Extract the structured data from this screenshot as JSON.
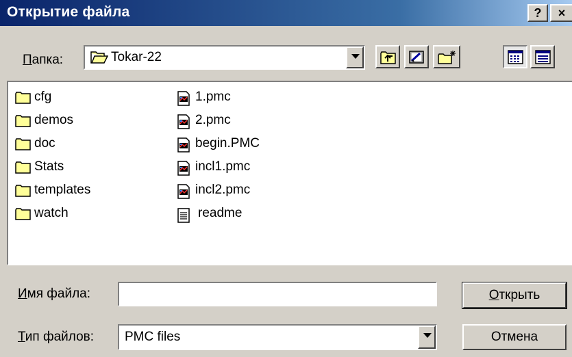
{
  "window": {
    "title": "Открытие файла",
    "help_button": "?",
    "close_button": "×"
  },
  "folder_bar": {
    "label_accel": "П",
    "label_rest": "апка:",
    "current_folder": "Tokar-22"
  },
  "toolbar": {
    "icons": [
      "up-folder-icon",
      "desktop-icon",
      "new-folder-icon",
      "list-view-icon",
      "details-view-icon"
    ]
  },
  "files": {
    "folders": [
      {
        "name": "cfg"
      },
      {
        "name": "demos"
      },
      {
        "name": "doc"
      },
      {
        "name": "Stats"
      },
      {
        "name": "templates"
      },
      {
        "name": "watch"
      }
    ],
    "documents": [
      {
        "name": "1.pmc",
        "icon": "pmc-file-icon"
      },
      {
        "name": "2.pmc",
        "icon": "pmc-file-icon"
      },
      {
        "name": "begin.PMC",
        "icon": "pmc-file-icon"
      },
      {
        "name": "incl1.pmc",
        "icon": "pmc-file-icon"
      },
      {
        "name": "incl2.pmc",
        "icon": "pmc-file-icon"
      },
      {
        "name": "readme",
        "icon": "text-file-icon"
      }
    ]
  },
  "filename": {
    "label_accel": "И",
    "label_rest": "мя файла:",
    "value": ""
  },
  "filetype": {
    "label_accel": "Т",
    "label_rest": "ип файлов:",
    "selected": "PMC files"
  },
  "buttons": {
    "open_accel": "О",
    "open_rest": "ткрыть",
    "cancel": "Отмена"
  },
  "colors": {
    "title_start": "#0a246a",
    "title_end": "#a6caf0",
    "face": "#d4d0c8",
    "folder": "#ffff99"
  }
}
